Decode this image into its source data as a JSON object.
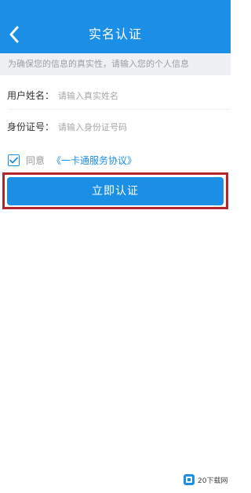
{
  "header": {
    "title": "实名认证",
    "back_icon": "chevron-left-icon",
    "color": "#1b8ee6"
  },
  "notice": {
    "text": "为确保您的信息的真实性，请输入您的个人信息"
  },
  "form": {
    "name_label": "用户姓名：",
    "name_placeholder": "请输入真实姓名",
    "name_value": "",
    "id_label": "身份证号：",
    "id_placeholder": "请输入身份证号码",
    "id_value": ""
  },
  "agreement": {
    "checked": true,
    "prefix": "同意",
    "link": "《一卡通服务协议》"
  },
  "submit": {
    "label": "立即认证"
  },
  "watermark": {
    "text": "20下载网",
    "icon": "logo-icon"
  },
  "colors": {
    "primary": "#1b8ee6",
    "highlight_frame": "#b3252a",
    "notice_background": "#eef0f3"
  }
}
